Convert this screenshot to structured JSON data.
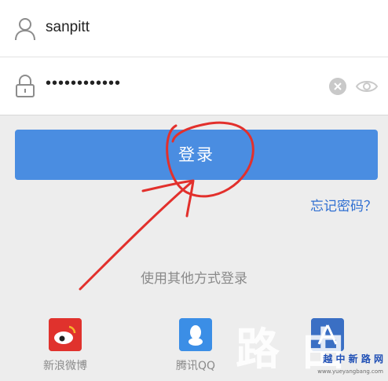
{
  "form": {
    "username_value": "sanpitt",
    "password_value": "••••••••••••",
    "username_icon": "user-icon",
    "password_icon": "lock-icon",
    "clear_icon": "clear-x-icon",
    "visibility_icon": "eye-icon"
  },
  "login": {
    "label": "登录"
  },
  "forgot": {
    "label": "忘记密码？"
  },
  "other_login": {
    "label": "使用其他方式登录",
    "providers": [
      {
        "label": "新浪微博",
        "icon": "weibo-icon",
        "color": "#e0322d"
      },
      {
        "label": "腾讯QQ",
        "icon": "qq-icon",
        "color": "#3b8ee6"
      },
      {
        "label": "",
        "icon": "app-icon",
        "color": "#3a6fc4"
      }
    ]
  },
  "watermark": {
    "brand": "越 中 新 路 网",
    "url": "www.yueyangbang.com",
    "big": "路 由 "
  },
  "colors": {
    "accent": "#4a8de1",
    "link": "#2f6fd1",
    "annotation": "#e2302c"
  }
}
